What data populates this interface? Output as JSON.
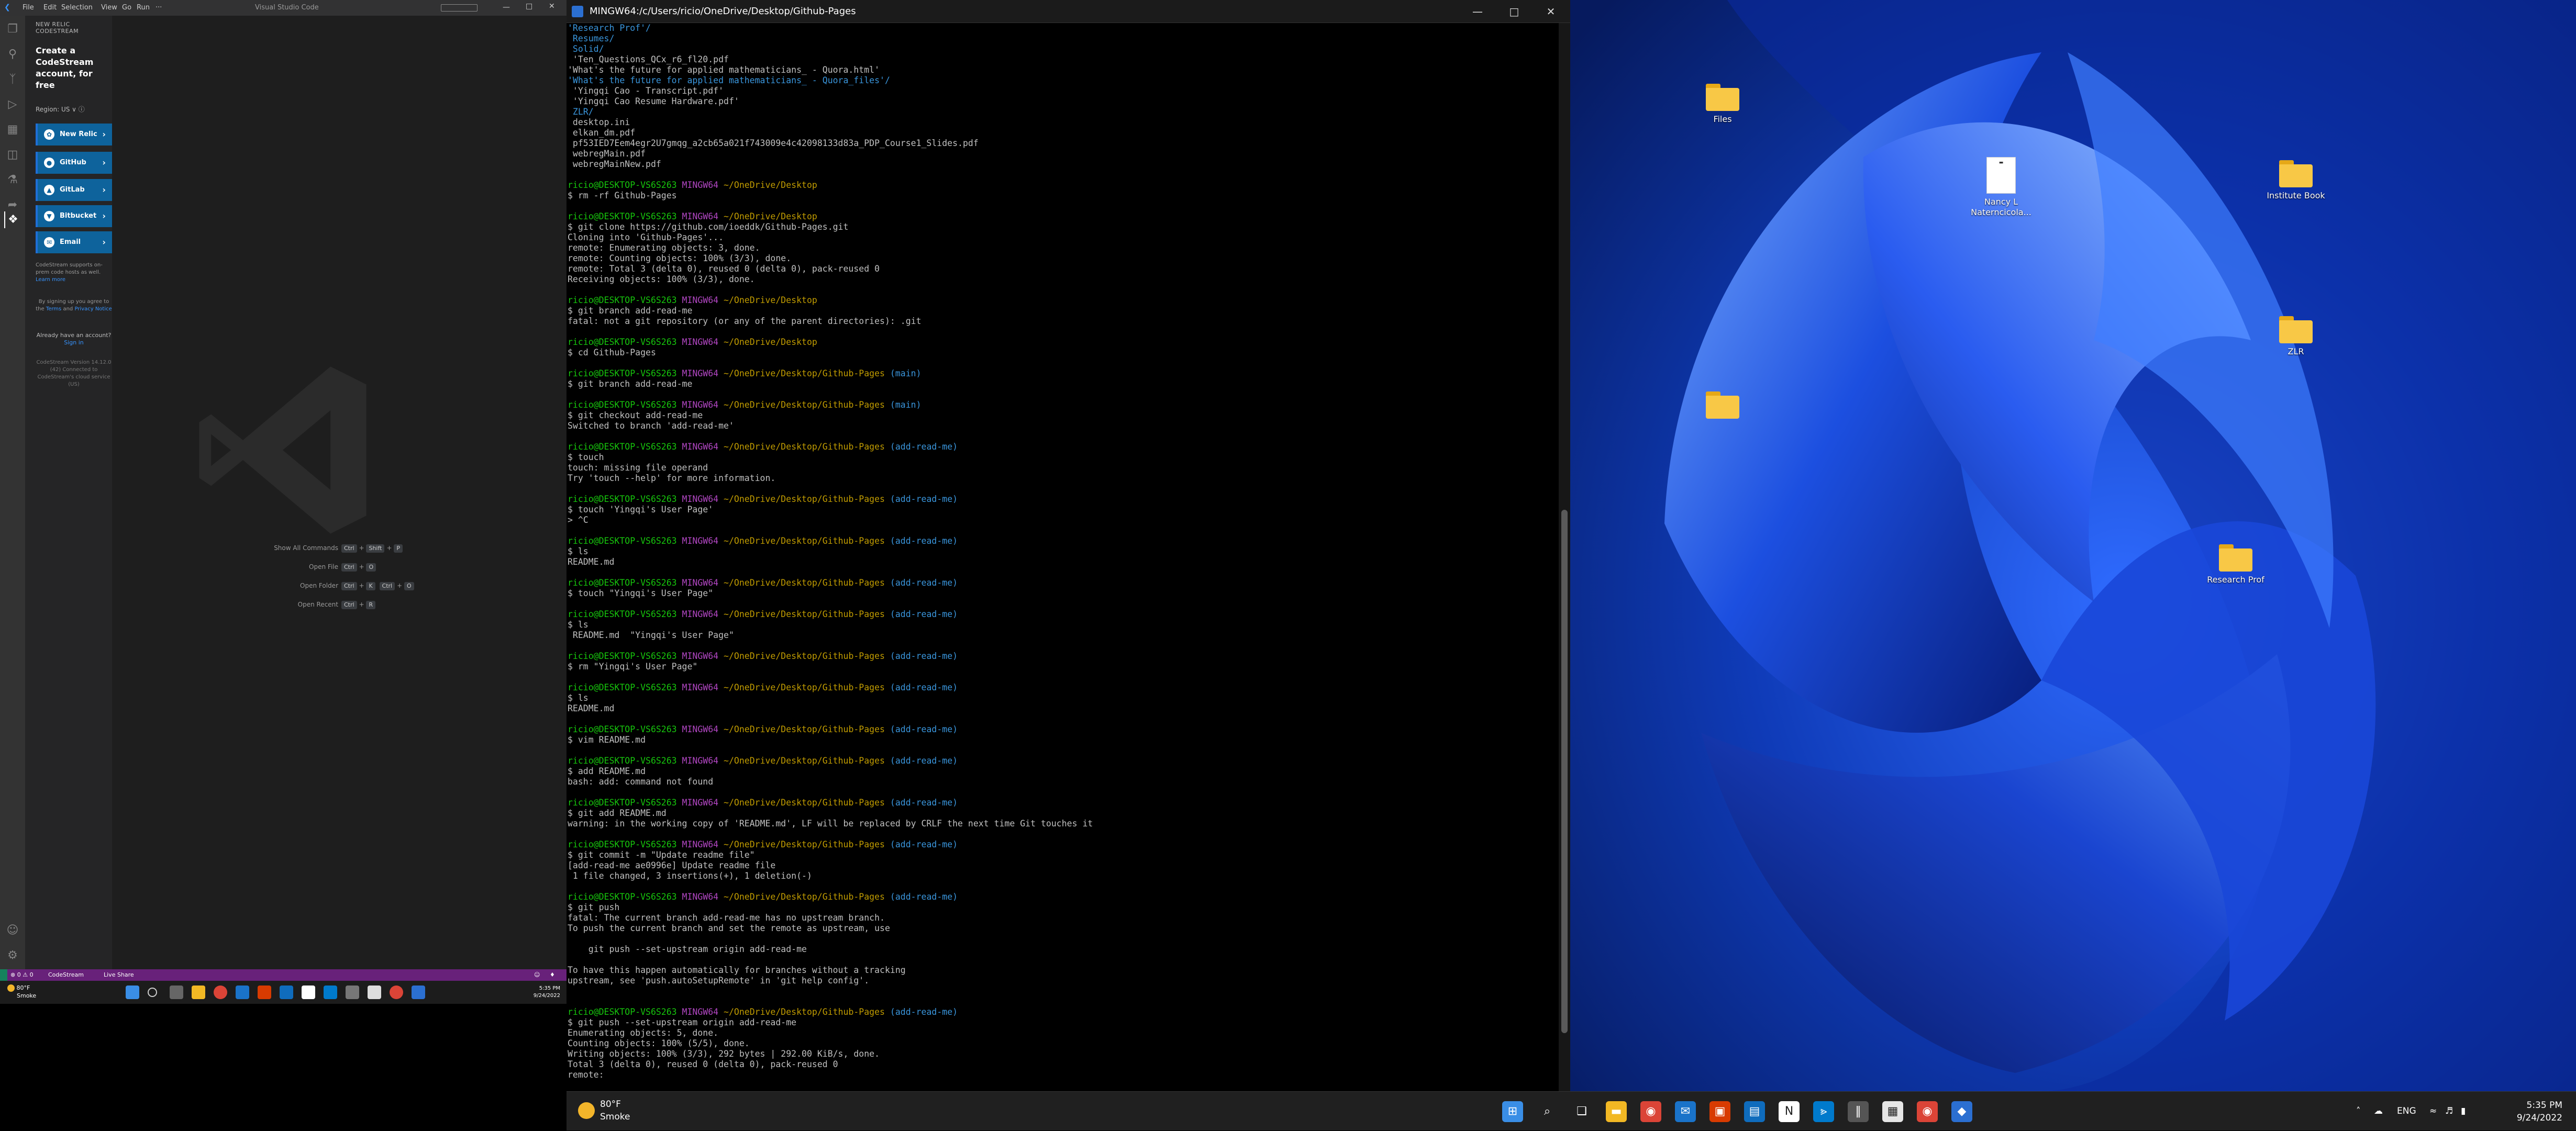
{
  "vscode": {
    "window_title": "Visual Studio Code",
    "menu": [
      "File",
      "Edit",
      "Selection",
      "View",
      "Go",
      "Run",
      "···"
    ],
    "sidebar": {
      "header": "NEW RELIC CODESTREAM",
      "title": "Create a CodeStream account, for free",
      "region": "Region: US ∨ ⓘ",
      "buttons": [
        {
          "label": "New Relic",
          "icon": "new-relic-icon",
          "color": "#0e639c"
        },
        {
          "label": "GitHub",
          "icon": "github-icon",
          "color": "#0e639c"
        },
        {
          "label": "GitLab",
          "icon": "gitlab-icon",
          "color": "#0e639c"
        },
        {
          "label": "Bitbucket",
          "icon": "bitbucket-icon",
          "color": "#0e639c"
        },
        {
          "label": "Email",
          "icon": "email-icon",
          "color": "#0e639c"
        }
      ],
      "supports_text": "CodeStream supports on-prem code hosts as well.",
      "supports_link": "Learn more",
      "terms_pre": "By signing up you agree to the",
      "terms_link1": "Terms",
      "terms_and": "and",
      "terms_link2": "Privacy Notice",
      "already_text": "Already have an account?",
      "signin_link": "Sign in",
      "version_text": "CodeStream Version 14.12.0 (42) Connected to CodeStream's cloud service (US)"
    },
    "shortcuts": [
      {
        "label": "Show All Commands",
        "keys": [
          "Ctrl",
          "+",
          "Shift",
          "+",
          "P"
        ]
      },
      {
        "label": "Open File",
        "keys": [
          "Ctrl",
          "+",
          "O"
        ]
      },
      {
        "label": "Open Folder",
        "keys": [
          "Ctrl",
          "+",
          "K",
          "Ctrl",
          "+",
          "O"
        ]
      },
      {
        "label": "Open Recent",
        "keys": [
          "Ctrl",
          "+",
          "R"
        ]
      }
    ],
    "status": {
      "problems": "⊗ 0 ⚠ 0",
      "codestream": "CodeStream",
      "liveshare": "Live Share"
    },
    "left_taskbar": {
      "weather_temp": "80°F",
      "weather_desc": "Smoke",
      "time": "5:35 PM",
      "date": "9/24/2022"
    }
  },
  "terminal": {
    "title": "MINGW64:/c/Users/ricio/OneDrive/Desktop/Github-Pages",
    "lines": [
      [
        [
          "'Research Prof'/",
          "c"
        ]
      ],
      [
        [
          " Resumes/",
          "c"
        ]
      ],
      [
        [
          " Solid/",
          "c"
        ]
      ],
      [
        [
          " 'Ten_Questions_QCx_r6_fl20.pdf",
          "w"
        ]
      ],
      [
        [
          "'What's the future for applied mathematicians_ - Quora.html'",
          "w"
        ]
      ],
      [
        [
          "'What's the future for applied mathematicians_ - Quora_files'/",
          "c"
        ]
      ],
      [
        [
          " 'Yingqi Cao - Transcript.pdf'",
          "w"
        ]
      ],
      [
        [
          " 'Yingqi Cao Resume Hardware.pdf'",
          "w"
        ]
      ],
      [
        [
          " ZLR/",
          "c"
        ]
      ],
      [
        [
          " desktop.ini",
          "w"
        ]
      ],
      [
        [
          " elkan_dm.pdf",
          "w"
        ]
      ],
      [
        [
          " pf53IED7Eem4egr2U7gmqg_a2cb65a021f743009e4c42098133d83a_PDP_Course1_Slides.pdf",
          "w"
        ]
      ],
      [
        [
          " webregMain.pdf",
          "w"
        ]
      ],
      [
        [
          " webregMainNew.pdf",
          "w"
        ]
      ],
      [
        [
          "",
          "w"
        ]
      ],
      [
        [
          "ricio@DESKTOP-VS6S263 ",
          "g"
        ],
        [
          "MINGW64 ",
          "m"
        ],
        [
          "~/OneDrive/Desktop",
          "y"
        ]
      ],
      [
        [
          "$ rm -rf Github-Pages",
          "w"
        ]
      ],
      [
        [
          "",
          "w"
        ]
      ],
      [
        [
          "ricio@DESKTOP-VS6S263 ",
          "g"
        ],
        [
          "MINGW64 ",
          "m"
        ],
        [
          "~/OneDrive/Desktop",
          "y"
        ]
      ],
      [
        [
          "$ git clone https://github.com/ioeddk/Github-Pages.git",
          "w"
        ]
      ],
      [
        [
          "Cloning into 'Github-Pages'...",
          "w"
        ]
      ],
      [
        [
          "remote: Enumerating objects: 3, done.",
          "w"
        ]
      ],
      [
        [
          "remote: Counting objects: 100% (3/3), done.",
          "w"
        ]
      ],
      [
        [
          "remote: Total 3 (delta 0), reused 0 (delta 0), pack-reused 0",
          "w"
        ]
      ],
      [
        [
          "Receiving objects: 100% (3/3), done.",
          "w"
        ]
      ],
      [
        [
          "",
          "w"
        ]
      ],
      [
        [
          "ricio@DESKTOP-VS6S263 ",
          "g"
        ],
        [
          "MINGW64 ",
          "m"
        ],
        [
          "~/OneDrive/Desktop",
          "y"
        ]
      ],
      [
        [
          "$ git branch add-read-me",
          "w"
        ]
      ],
      [
        [
          "fatal: not a git repository (or any of the parent directories): .git",
          "w"
        ]
      ],
      [
        [
          "",
          "w"
        ]
      ],
      [
        [
          "ricio@DESKTOP-VS6S263 ",
          "g"
        ],
        [
          "MINGW64 ",
          "m"
        ],
        [
          "~/OneDrive/Desktop",
          "y"
        ]
      ],
      [
        [
          "$ cd Github-Pages",
          "w"
        ]
      ],
      [
        [
          "",
          "w"
        ]
      ],
      [
        [
          "ricio@DESKTOP-VS6S263 ",
          "g"
        ],
        [
          "MINGW64 ",
          "m"
        ],
        [
          "~/OneDrive/Desktop/Github-Pages ",
          "y"
        ],
        [
          "(main)",
          "c"
        ]
      ],
      [
        [
          "$ git branch add-read-me",
          "w"
        ]
      ],
      [
        [
          "",
          "w"
        ]
      ],
      [
        [
          "ricio@DESKTOP-VS6S263 ",
          "g"
        ],
        [
          "MINGW64 ",
          "m"
        ],
        [
          "~/OneDrive/Desktop/Github-Pages ",
          "y"
        ],
        [
          "(main)",
          "c"
        ]
      ],
      [
        [
          "$ git checkout add-read-me",
          "w"
        ]
      ],
      [
        [
          "Switched to branch 'add-read-me'",
          "w"
        ]
      ],
      [
        [
          "",
          "w"
        ]
      ],
      [
        [
          "ricio@DESKTOP-VS6S263 ",
          "g"
        ],
        [
          "MINGW64 ",
          "m"
        ],
        [
          "~/OneDrive/Desktop/Github-Pages ",
          "y"
        ],
        [
          "(add-read-me)",
          "c"
        ]
      ],
      [
        [
          "$ touch",
          "w"
        ]
      ],
      [
        [
          "touch: missing file operand",
          "w"
        ]
      ],
      [
        [
          "Try 'touch --help' for more information.",
          "w"
        ]
      ],
      [
        [
          "",
          "w"
        ]
      ],
      [
        [
          "ricio@DESKTOP-VS6S263 ",
          "g"
        ],
        [
          "MINGW64 ",
          "m"
        ],
        [
          "~/OneDrive/Desktop/Github-Pages ",
          "y"
        ],
        [
          "(add-read-me)",
          "c"
        ]
      ],
      [
        [
          "$ touch 'Yingqi's User Page'",
          "w"
        ]
      ],
      [
        [
          "> ^C",
          "w"
        ]
      ],
      [
        [
          "",
          "w"
        ]
      ],
      [
        [
          "ricio@DESKTOP-VS6S263 ",
          "g"
        ],
        [
          "MINGW64 ",
          "m"
        ],
        [
          "~/OneDrive/Desktop/Github-Pages ",
          "y"
        ],
        [
          "(add-read-me)",
          "c"
        ]
      ],
      [
        [
          "$ ls",
          "w"
        ]
      ],
      [
        [
          "README.md",
          "w"
        ]
      ],
      [
        [
          "",
          "w"
        ]
      ],
      [
        [
          "ricio@DESKTOP-VS6S263 ",
          "g"
        ],
        [
          "MINGW64 ",
          "m"
        ],
        [
          "~/OneDrive/Desktop/Github-Pages ",
          "y"
        ],
        [
          "(add-read-me)",
          "c"
        ]
      ],
      [
        [
          "$ touch \"Yingqi's User Page\"",
          "w"
        ]
      ],
      [
        [
          "",
          "w"
        ]
      ],
      [
        [
          "ricio@DESKTOP-VS6S263 ",
          "g"
        ],
        [
          "MINGW64 ",
          "m"
        ],
        [
          "~/OneDrive/Desktop/Github-Pages ",
          "y"
        ],
        [
          "(add-read-me)",
          "c"
        ]
      ],
      [
        [
          "$ ls",
          "w"
        ]
      ],
      [
        [
          " README.md  \"Yingqi's User Page\"",
          "w"
        ]
      ],
      [
        [
          "",
          "w"
        ]
      ],
      [
        [
          "ricio@DESKTOP-VS6S263 ",
          "g"
        ],
        [
          "MINGW64 ",
          "m"
        ],
        [
          "~/OneDrive/Desktop/Github-Pages ",
          "y"
        ],
        [
          "(add-read-me)",
          "c"
        ]
      ],
      [
        [
          "$ rm \"Yingqi's User Page\"",
          "w"
        ]
      ],
      [
        [
          "",
          "w"
        ]
      ],
      [
        [
          "ricio@DESKTOP-VS6S263 ",
          "g"
        ],
        [
          "MINGW64 ",
          "m"
        ],
        [
          "~/OneDrive/Desktop/Github-Pages ",
          "y"
        ],
        [
          "(add-read-me)",
          "c"
        ]
      ],
      [
        [
          "$ ls",
          "w"
        ]
      ],
      [
        [
          "README.md",
          "w"
        ]
      ],
      [
        [
          "",
          "w"
        ]
      ],
      [
        [
          "ricio@DESKTOP-VS6S263 ",
          "g"
        ],
        [
          "MINGW64 ",
          "m"
        ],
        [
          "~/OneDrive/Desktop/Github-Pages ",
          "y"
        ],
        [
          "(add-read-me)",
          "c"
        ]
      ],
      [
        [
          "$ vim README.md",
          "w"
        ]
      ],
      [
        [
          "",
          "w"
        ]
      ],
      [
        [
          "ricio@DESKTOP-VS6S263 ",
          "g"
        ],
        [
          "MINGW64 ",
          "m"
        ],
        [
          "~/OneDrive/Desktop/Github-Pages ",
          "y"
        ],
        [
          "(add-read-me)",
          "c"
        ]
      ],
      [
        [
          "$ add README.md",
          "w"
        ]
      ],
      [
        [
          "bash: add: command not found",
          "w"
        ]
      ],
      [
        [
          "",
          "w"
        ]
      ],
      [
        [
          "ricio@DESKTOP-VS6S263 ",
          "g"
        ],
        [
          "MINGW64 ",
          "m"
        ],
        [
          "~/OneDrive/Desktop/Github-Pages ",
          "y"
        ],
        [
          "(add-read-me)",
          "c"
        ]
      ],
      [
        [
          "$ git add README.md",
          "w"
        ]
      ],
      [
        [
          "warning: in the working copy of 'README.md', LF will be replaced by CRLF the next time Git touches it",
          "w"
        ]
      ],
      [
        [
          "",
          "w"
        ]
      ],
      [
        [
          "ricio@DESKTOP-VS6S263 ",
          "g"
        ],
        [
          "MINGW64 ",
          "m"
        ],
        [
          "~/OneDrive/Desktop/Github-Pages ",
          "y"
        ],
        [
          "(add-read-me)",
          "c"
        ]
      ],
      [
        [
          "$ git commit -m \"Update readme file\"",
          "w"
        ]
      ],
      [
        [
          "[add-read-me ae0996e] Update readme file",
          "w"
        ]
      ],
      [
        [
          " 1 file changed, 3 insertions(+), 1 deletion(-)",
          "w"
        ]
      ],
      [
        [
          "",
          "w"
        ]
      ],
      [
        [
          "ricio@DESKTOP-VS6S263 ",
          "g"
        ],
        [
          "MINGW64 ",
          "m"
        ],
        [
          "~/OneDrive/Desktop/Github-Pages ",
          "y"
        ],
        [
          "(add-read-me)",
          "c"
        ]
      ],
      [
        [
          "$ git push",
          "w"
        ]
      ],
      [
        [
          "fatal: The current branch add-read-me has no upstream branch.",
          "w"
        ]
      ],
      [
        [
          "To push the current branch and set the remote as upstream, use",
          "w"
        ]
      ],
      [
        [
          "",
          "w"
        ]
      ],
      [
        [
          "    git push --set-upstream origin add-read-me",
          "w"
        ]
      ],
      [
        [
          "",
          "w"
        ]
      ],
      [
        [
          "To have this happen automatically for branches without a tracking",
          "w"
        ]
      ],
      [
        [
          "upstream, see 'push.autoSetupRemote' in 'git help config'.",
          "w"
        ]
      ],
      [
        [
          "",
          "w"
        ]
      ],
      [
        [
          "",
          "w"
        ]
      ],
      [
        [
          "ricio@DESKTOP-VS6S263 ",
          "g"
        ],
        [
          "MINGW64 ",
          "m"
        ],
        [
          "~/OneDrive/Desktop/Github-Pages ",
          "y"
        ],
        [
          "(add-read-me)",
          "c"
        ]
      ],
      [
        [
          "$ git push --set-upstream origin add-read-me",
          "w"
        ]
      ],
      [
        [
          "Enumerating objects: 5, done.",
          "w"
        ]
      ],
      [
        [
          "Counting objects: 100% (5/5), done.",
          "w"
        ]
      ],
      [
        [
          "Writing objects: 100% (3/3), 292 bytes | 292.00 KiB/s, done.",
          "w"
        ]
      ],
      [
        [
          "Total 3 (delta 0), reused 0 (delta 0), pack-reused 0",
          "w"
        ]
      ],
      [
        [
          "remote:",
          "w"
        ]
      ]
    ]
  },
  "desktop": {
    "icons": [
      {
        "label": "Files",
        "kind": "folder"
      },
      {
        "label": "Nancy L Naterncicola...",
        "kind": "document"
      },
      {
        "label": "Institute Book",
        "kind": "folder"
      },
      {
        "label": "ZLR",
        "kind": "folder"
      },
      {
        "label": "",
        "kind": "folder"
      },
      {
        "label": "Research Prof",
        "kind": "folder"
      }
    ]
  },
  "taskbar": {
    "weather_temp": "80°F",
    "weather_desc": "Smoke",
    "language": "ENG",
    "time": "5:35 PM",
    "date": "9/24/2022",
    "apps": [
      {
        "name": "start-icon",
        "color": "#3a8ee6",
        "glyph": "⊞"
      },
      {
        "name": "search-icon",
        "color": "transparent",
        "glyph": "⌕"
      },
      {
        "name": "task-view-icon",
        "color": "transparent",
        "glyph": "❑"
      },
      {
        "name": "file-explorer-icon",
        "color": "#f2b824",
        "glyph": "▬"
      },
      {
        "name": "chrome-icon",
        "color": "#db4437",
        "glyph": "◉"
      },
      {
        "name": "mail-icon",
        "color": "#1a73c9",
        "glyph": "✉"
      },
      {
        "name": "office-icon",
        "color": "#d83b01",
        "glyph": "▣"
      },
      {
        "name": "outlook-icon",
        "color": "#0f6cbd",
        "glyph": "▤"
      },
      {
        "name": "notion-icon",
        "color": "#ffffff",
        "glyph": "N"
      },
      {
        "name": "vscode-icon",
        "color": "#007acc",
        "glyph": "⪢"
      },
      {
        "name": "library-icon",
        "color": "#555555",
        "glyph": "‖"
      },
      {
        "name": "store-icon",
        "color": "#e6e6e6",
        "glyph": "▦"
      },
      {
        "name": "chrome-alt-icon",
        "color": "#db4437",
        "glyph": "◉"
      },
      {
        "name": "git-bash-icon",
        "color": "#2b6fd1",
        "glyph": "◆"
      }
    ]
  }
}
